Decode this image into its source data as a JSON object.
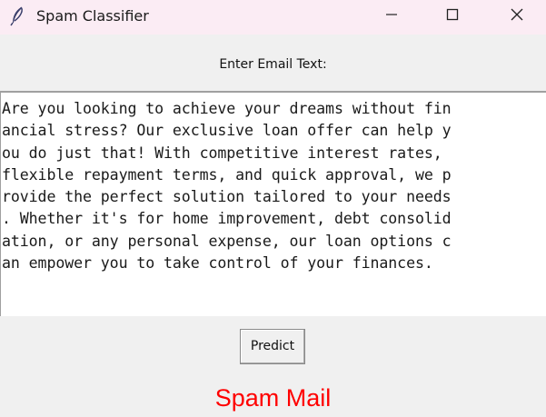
{
  "window": {
    "title": "Spam Classifier",
    "icon": "feather-icon"
  },
  "window_controls": {
    "minimize_icon": "minimize-icon",
    "maximize_icon": "maximize-icon",
    "close_icon": "close-icon"
  },
  "form": {
    "label": "Enter Email Text:",
    "email_lines": [
      "Are you looking to achieve your dreams without fin",
      "ancial stress? Our exclusive loan offer can help y",
      "ou do just that! With competitive interest rates,",
      "flexible repayment terms, and quick approval, we p",
      "rovide the perfect solution tailored to your needs",
      ". Whether it's for home improvement, debt consolid",
      "ation, or any personal expense, our loan options c",
      "an empower you to take control of your finances."
    ],
    "predict_label": "Predict"
  },
  "result": {
    "text": "Spam Mail",
    "color": "#ff0000"
  }
}
